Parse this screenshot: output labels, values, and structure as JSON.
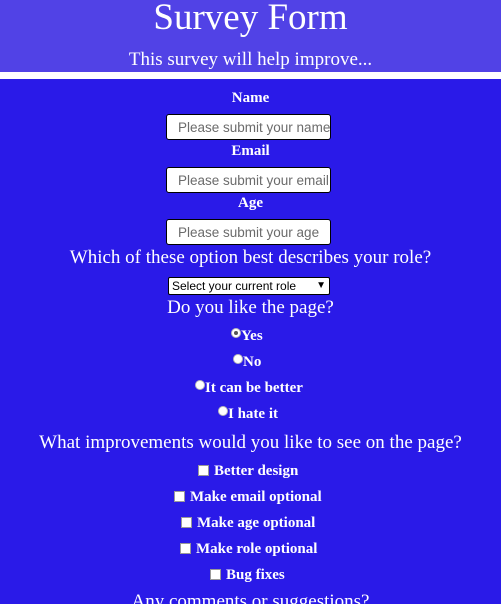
{
  "header": {
    "title": "Survey Form",
    "subtitle": "This survey will help improve..."
  },
  "form": {
    "name": {
      "label": "Name",
      "placeholder": "Please submit your name"
    },
    "email": {
      "label": "Email",
      "placeholder": "Please submit your email"
    },
    "age": {
      "label": "Age",
      "placeholder": "Please submit your age"
    },
    "role": {
      "question": "Which of these option best describes your role?",
      "selected": "Select your current role"
    },
    "like": {
      "question": "Do you like the page?",
      "options": [
        "Yes",
        "No",
        "It can be better",
        "I hate it"
      ],
      "checked": "Yes"
    },
    "improvements": {
      "question": "What improvements would you like to see on the page?",
      "options": [
        "Better design",
        "Make email optional",
        "Make age optional",
        "Make role optional",
        "Bug fixes"
      ]
    },
    "comments": {
      "question": "Any comments or suggestions?"
    }
  }
}
